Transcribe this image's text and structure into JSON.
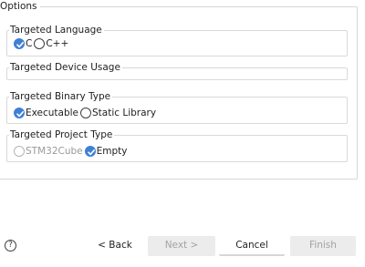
{
  "options": {
    "legend": "Options",
    "language": {
      "legend": "Targeted Language",
      "items": [
        {
          "label": "C",
          "checked": true
        },
        {
          "label": "C++",
          "checked": false
        }
      ]
    },
    "device": {
      "legend": "Targeted Device Usage"
    },
    "binary": {
      "legend": "Targeted Binary Type",
      "items": [
        {
          "label": "Executable",
          "checked": true
        },
        {
          "label": "Static Library",
          "checked": false
        }
      ]
    },
    "project": {
      "legend": "Targeted Project Type",
      "items": [
        {
          "label": "STM32Cube",
          "checked": false,
          "enabled": false
        },
        {
          "label": "Empty",
          "checked": true,
          "enabled": true
        }
      ]
    }
  },
  "footer": {
    "help_icon": "question-mark-icon",
    "help_glyph": "?",
    "back_label": "< Back",
    "next_label": "Next >",
    "cancel_label": "Cancel",
    "finish_label": "Finish"
  },
  "colors": {
    "accent": "#3f80d6",
    "border": "#d9d9d9",
    "disabled_button": "#ececec",
    "disabled_text": "#9a9a9a"
  }
}
